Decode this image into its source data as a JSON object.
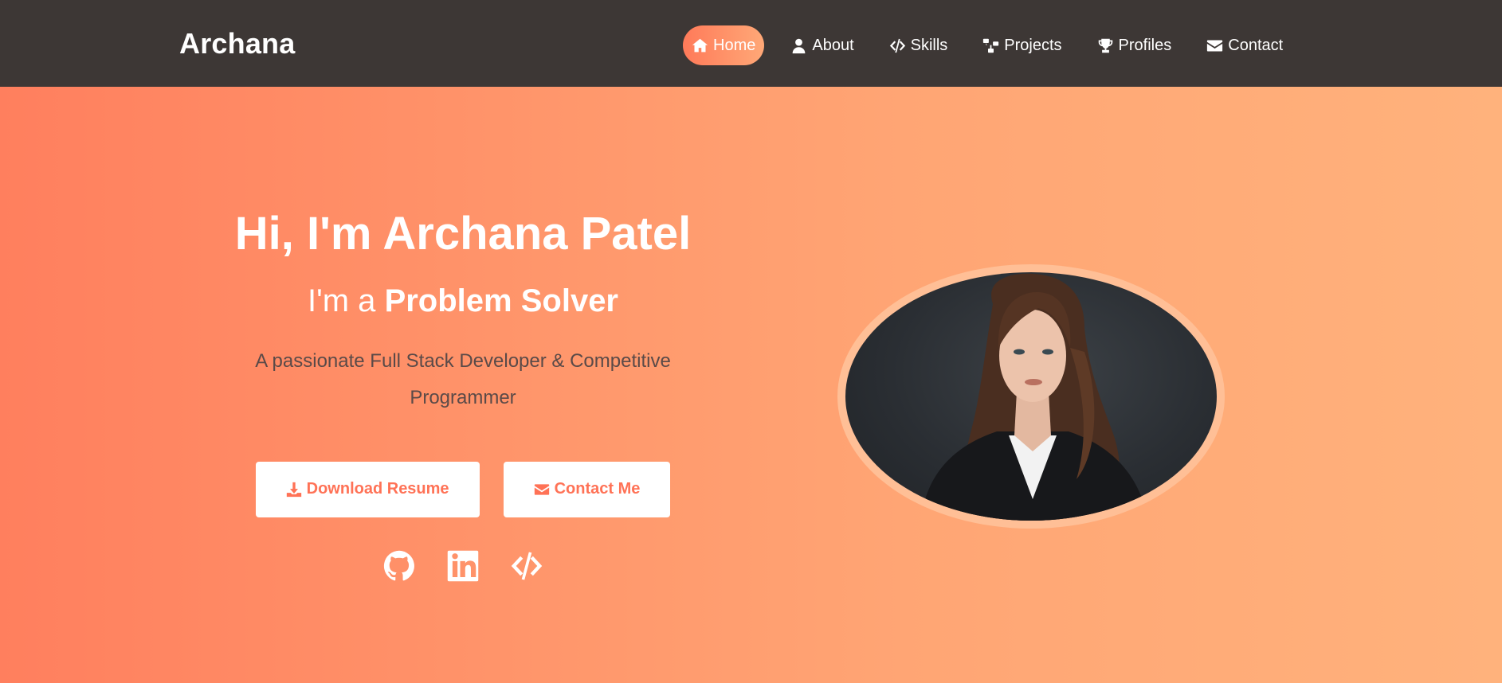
{
  "brand": "Archana",
  "nav": [
    {
      "label": "Home",
      "icon": "home-icon",
      "active": true
    },
    {
      "label": "About",
      "icon": "user-icon"
    },
    {
      "label": "Skills",
      "icon": "code-icon"
    },
    {
      "label": "Projects",
      "icon": "sitemap-icon"
    },
    {
      "label": "Profiles",
      "icon": "trophy-icon"
    },
    {
      "label": "Contact",
      "icon": "envelope-icon"
    }
  ],
  "hero": {
    "greeting": "Hi, I'm Archana Patel",
    "role_prefix": "I'm a",
    "role": "Problem Solver",
    "description": "A passionate Full Stack Developer & Competitive Programmer",
    "buttons": {
      "download": "Download Resume",
      "contact": "Contact Me"
    },
    "social": [
      "github-icon",
      "linkedin-icon",
      "code-icon"
    ]
  },
  "colors": {
    "navbar": "#3d3735",
    "gradient_start": "#ff7f5e",
    "gradient_end": "#ffb27c",
    "accent": "#ff7256",
    "ring": "#ffbf96"
  }
}
